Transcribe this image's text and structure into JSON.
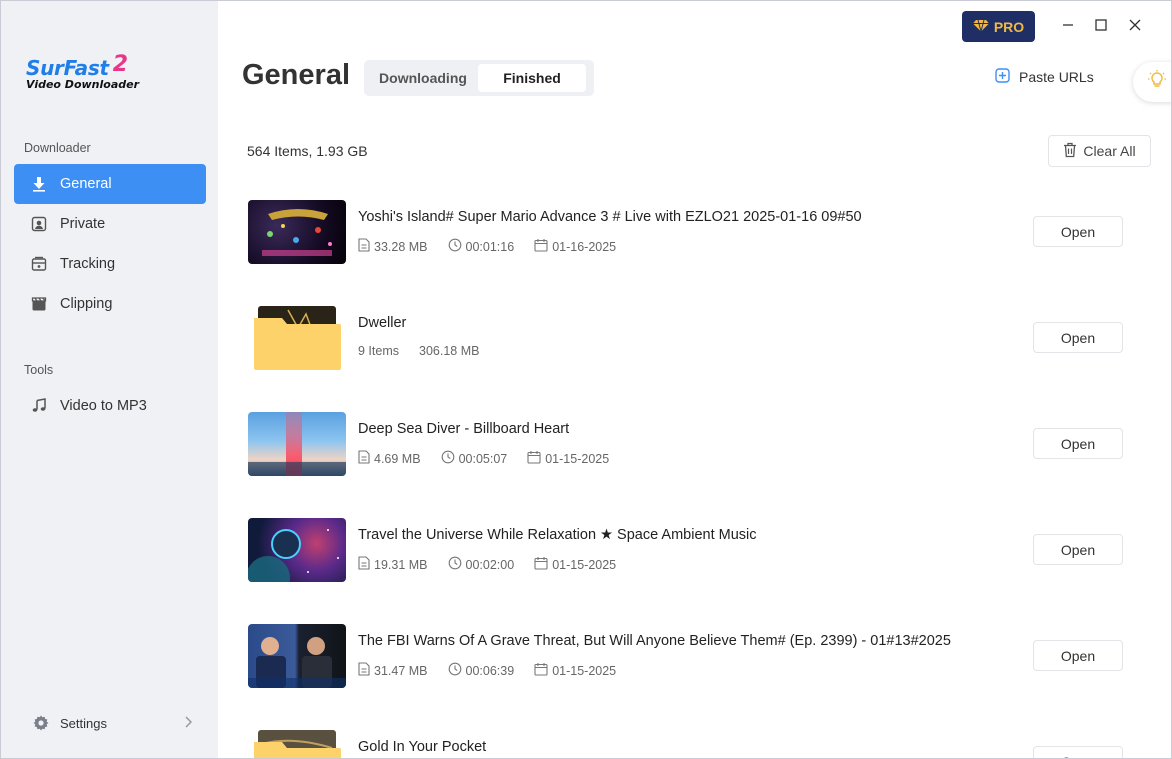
{
  "app": {
    "logo_name": "SurFast",
    "logo_version": "2",
    "logo_subtitle": "Video Downloader"
  },
  "sidebar": {
    "downloader_label": "Downloader",
    "tools_label": "Tools",
    "items": [
      {
        "label": "General",
        "icon": "download-icon",
        "active": true
      },
      {
        "label": "Private",
        "icon": "private-icon"
      },
      {
        "label": "Tracking",
        "icon": "tracking-icon"
      },
      {
        "label": "Clipping",
        "icon": "clipping-icon"
      }
    ],
    "tools": [
      {
        "label": "Video to MP3",
        "icon": "music-note-icon"
      }
    ],
    "settings_label": "Settings"
  },
  "header": {
    "title": "General",
    "tabs": [
      {
        "label": "Downloading",
        "active": false
      },
      {
        "label": "Finished",
        "active": true
      }
    ],
    "paste_label": "Paste URLs",
    "pro_label": "PRO"
  },
  "list": {
    "summary": "564 Items, 1.93 GB",
    "clear_label": "Clear All",
    "open_label": "Open",
    "items": [
      {
        "title": "Yoshi's Island# Super Mario Advance 3 # Live with EZLO21 2025-01-16 09#50",
        "size": "33.28 MB",
        "duration": "00:01:16",
        "date": "01-16-2025",
        "type": "video"
      },
      {
        "title": "Dweller",
        "count": "9 Items",
        "size": "306.18 MB",
        "type": "folder"
      },
      {
        "title": "Deep Sea Diver - Billboard Heart",
        "size": "4.69 MB",
        "duration": "00:05:07",
        "date": "01-15-2025",
        "type": "video"
      },
      {
        "title": "Travel the Universe While Relaxation ★ Space Ambient Music",
        "size": "19.31 MB",
        "duration": "00:02:00",
        "date": "01-15-2025",
        "type": "video"
      },
      {
        "title": "The FBI Warns Of A Grave Threat, But Will Anyone Believe Them# (Ep. 2399) - 01#13#2025",
        "size": "31.47 MB",
        "duration": "00:06:39",
        "date": "01-15-2025",
        "type": "video"
      },
      {
        "title": "Gold In Your Pocket",
        "type": "folder"
      }
    ]
  },
  "colors": {
    "accent": "#3d8ff3",
    "sidebar_bg": "#f0f1f5",
    "pro_bg": "#1f2f66",
    "pro_text": "#f2b840",
    "folder": "#fdd26b"
  }
}
